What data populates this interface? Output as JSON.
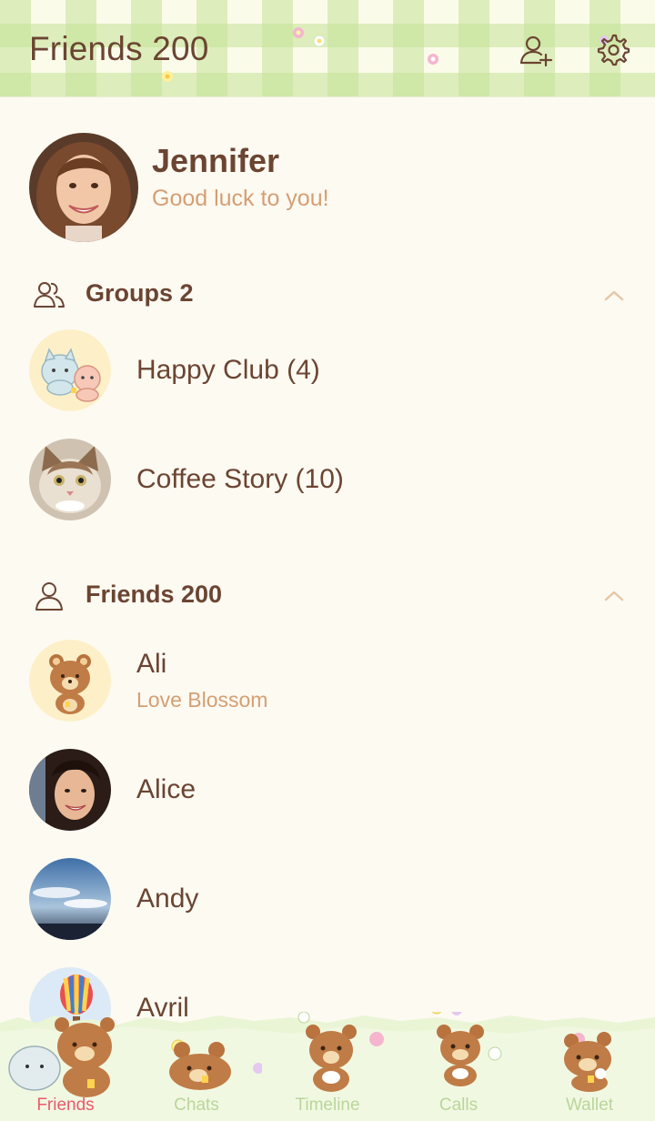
{
  "header": {
    "title": "Friends 200"
  },
  "profile": {
    "name": "Jennifer",
    "status": "Good luck to you!"
  },
  "groups": {
    "title": "Groups 2",
    "items": [
      {
        "name": "Happy Club (4)"
      },
      {
        "name": "Coffee Story (10)"
      }
    ]
  },
  "friends": {
    "title": "Friends 200",
    "items": [
      {
        "name": "Ali",
        "status": "Love Blossom"
      },
      {
        "name": "Alice"
      },
      {
        "name": "Andy"
      },
      {
        "name": "Avril"
      }
    ]
  },
  "nav": {
    "items": [
      {
        "label": "Friends",
        "icon": "bear-friends-icon",
        "active": true
      },
      {
        "label": "Chats",
        "icon": "bear-chats-icon",
        "active": false
      },
      {
        "label": "Timeline",
        "icon": "bear-timeline-icon",
        "active": false
      },
      {
        "label": "Calls",
        "icon": "bear-calls-icon",
        "active": false
      },
      {
        "label": "Wallet",
        "icon": "bear-wallet-icon",
        "active": false
      }
    ]
  },
  "colors": {
    "background": "#fdfaf2",
    "text": "#6b4532",
    "status": "#d49f73",
    "gingham": "#c4e296",
    "active_tab": "#e85b6a",
    "inactive_tab": "#b9d69a"
  }
}
